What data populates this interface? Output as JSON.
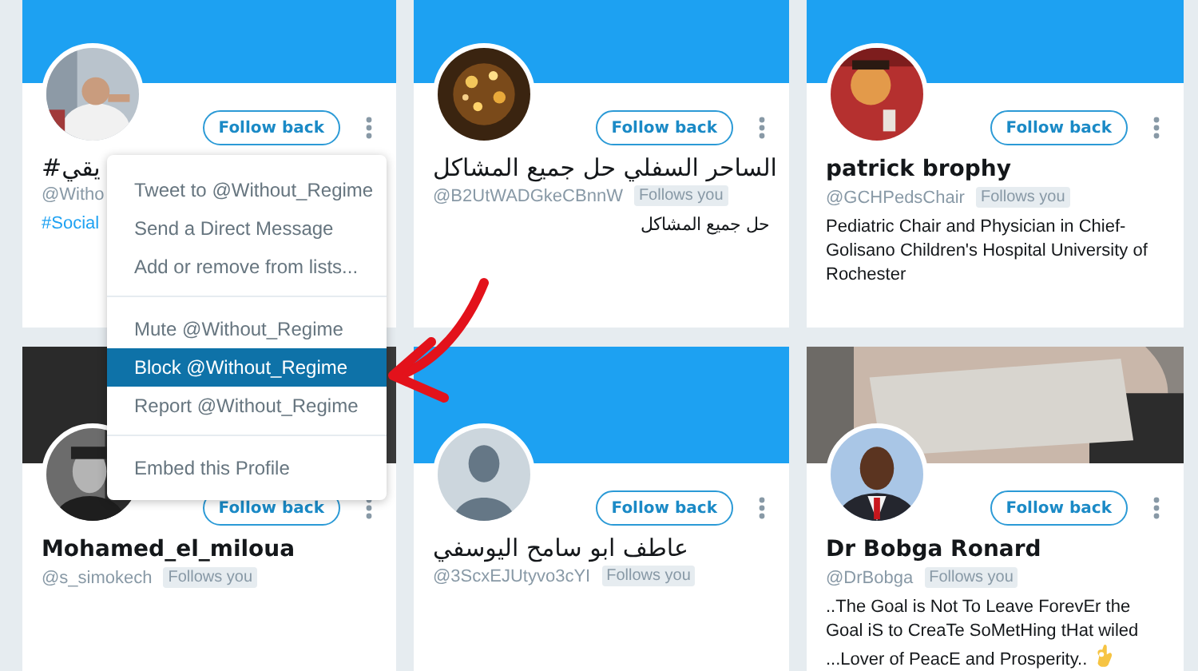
{
  "cards": [
    {
      "header": {
        "kind": "banner"
      },
      "name": "يقي#",
      "handle": "@Witho",
      "bio": {
        "kind": "hashtag",
        "text": "#Social"
      },
      "button": "Follow back"
    },
    {
      "header": {
        "kind": "banner"
      },
      "name": "الساحر السفلي حل جميع المشاكل",
      "handle": "@B2UtWADGkeCBnnW",
      "follows_label": "Follows you",
      "bio": {
        "kind": "plain",
        "text": "حل جميع المشاكل"
      },
      "button": "Follow back"
    },
    {
      "header": {
        "kind": "banner"
      },
      "name": "patrick brophy",
      "handle": "@GCHPedsChair",
      "follows_label": "Follows you",
      "bio": {
        "kind": "plain",
        "text": "Pediatric Chair and Physician in Chief-Golisano Children's Hospital University of Rochester"
      },
      "button": "Follow back"
    },
    {
      "name": "Mohamed_el_miloua",
      "handle": "@s_simokech",
      "follows_label": "Follows you",
      "button": "Follow back"
    },
    {
      "header": {
        "kind": "banner"
      },
      "avatar": {
        "kind": "default"
      },
      "name": "عاطف ابو سامح اليوسفي",
      "handle": "@3ScxEJUtyvo3cYI",
      "follows_label": "Follows you",
      "button": "Follow back"
    },
    {
      "name": "Dr Bobga Ronard",
      "handle": "@DrBobga",
      "follows_label": "Follows you",
      "bio": {
        "kind": "emoji",
        "text": "..The Goal is Not To Leave ForevEr the Goal iS to CreaTe SoMetHing tHat wiled ...Lover of PeacE and Prosperity.."
      },
      "button": "Follow back"
    }
  ],
  "menu": {
    "items": [
      {
        "label": "Tweet to @Without_Regime",
        "selected": false,
        "divider_before": false
      },
      {
        "label": "Send a Direct Message",
        "selected": false,
        "divider_before": false
      },
      {
        "label": "Add or remove from lists...",
        "selected": false,
        "divider_before": false
      },
      {
        "label": "Mute @Without_Regime",
        "selected": false,
        "divider_before": true
      },
      {
        "label": "Block @Without_Regime",
        "selected": true,
        "divider_before": false
      },
      {
        "label": "Report @Without_Regime",
        "selected": false,
        "divider_before": false
      },
      {
        "label": "Embed this Profile",
        "selected": false,
        "divider_before": true
      }
    ]
  }
}
